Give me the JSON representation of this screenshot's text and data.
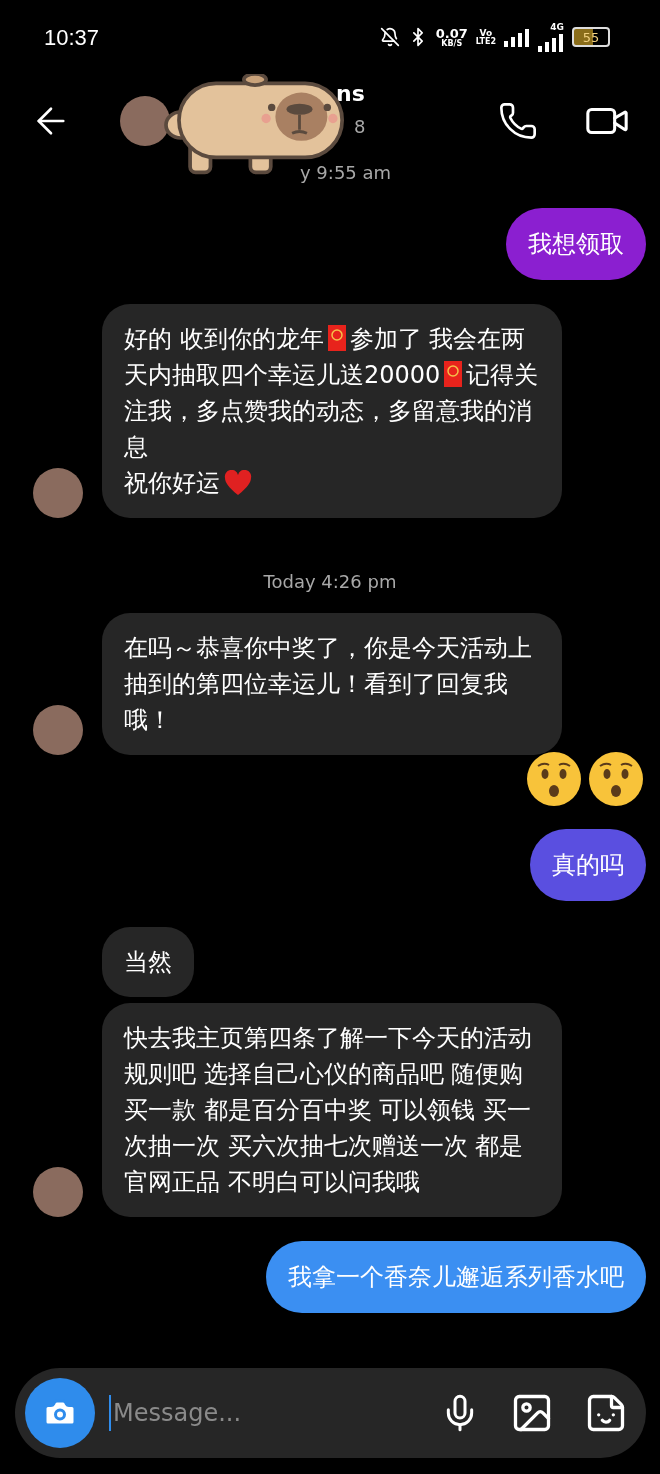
{
  "status_bar": {
    "time": "10:37",
    "speed_value": "0.07",
    "speed_unit": "KB/S",
    "volte_top": "Vo",
    "volte_bottom": "LTE2",
    "network": "4G",
    "battery": "55"
  },
  "header": {
    "name_visible": "ns",
    "subtitle_visible": "8",
    "active_visible": "y 9:55 am"
  },
  "messages": [
    {
      "kind": "outgoing",
      "color": "#8b1fd0",
      "parts": [
        {
          "kind": "text",
          "text": "我想领取"
        }
      ]
    },
    {
      "kind": "incoming",
      "avatar": true,
      "parts": [
        {
          "kind": "text",
          "text": "好的 收到你的龙年"
        },
        {
          "kind": "red_envelope"
        },
        {
          "kind": "text",
          "text": "参加了 我会在两天内抽取四个幸运儿送20000"
        },
        {
          "kind": "red_envelope"
        },
        {
          "kind": "text",
          "text": "记得关注我，多点赞我的动态，多留意我的消息"
        },
        {
          "kind": "line_break"
        },
        {
          "kind": "text",
          "text": "祝你好运"
        },
        {
          "kind": "heart"
        }
      ]
    },
    {
      "kind": "timestamp",
      "text": "Today 4:26 pm"
    },
    {
      "kind": "incoming",
      "avatar": true,
      "parts": [
        {
          "kind": "text",
          "text": "在吗～恭喜你中奖了，你是今天活动上抽到的第四位幸运儿！看到了回复我哦！"
        }
      ]
    },
    {
      "kind": "reaction",
      "parts": [
        {
          "kind": "hushed_face"
        },
        {
          "kind": "hushed_face"
        }
      ]
    },
    {
      "kind": "outgoing",
      "color": "#5a4fe0",
      "parts": [
        {
          "kind": "text",
          "text": "真的吗"
        }
      ]
    },
    {
      "kind": "incoming",
      "avatar": false,
      "parts": [
        {
          "kind": "text",
          "text": "当然"
        }
      ]
    },
    {
      "kind": "incoming",
      "avatar": true,
      "parts": [
        {
          "kind": "text",
          "text": "快去我主页第四条了解一下今天的活动规则吧 选择自己心仪的商品吧 随便购买一款 都是百分百中奖 可以领钱 买一次抽一次 买六次抽七次赠送一次 都是官网正品 不明白可以问我哦"
        }
      ]
    },
    {
      "kind": "outgoing",
      "color": "#3b8ff2",
      "parts": [
        {
          "kind": "text",
          "text": "我拿一个香奈儿邂逅系列香水吧"
        }
      ]
    }
  ],
  "composer": {
    "placeholder": "Message..."
  }
}
